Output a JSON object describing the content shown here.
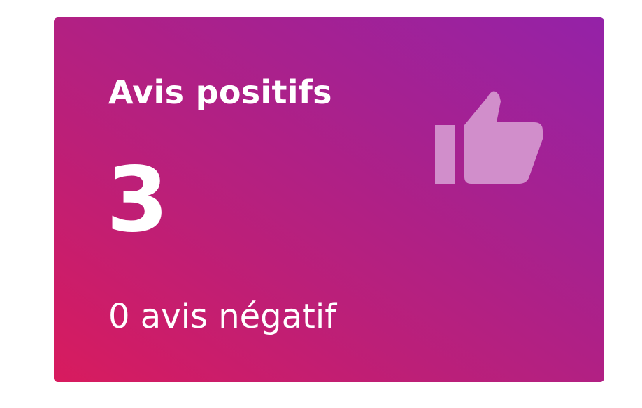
{
  "card": {
    "title": "Avis positifs",
    "value": "3",
    "subtitle": "0 avis négatif",
    "icon": "thumbs-up-icon",
    "colors": {
      "gradient_start": "#d81b5e",
      "gradient_end": "#9422a8",
      "icon": "#d18ecb"
    }
  }
}
